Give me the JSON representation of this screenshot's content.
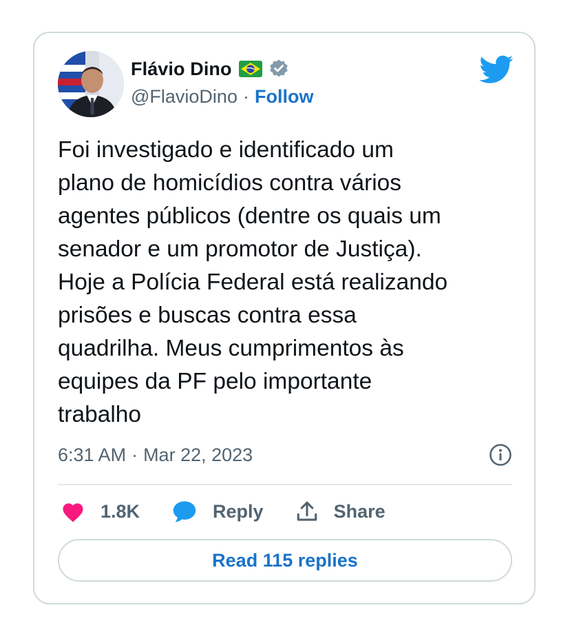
{
  "tweet": {
    "author": {
      "name": "Flávio Dino",
      "handle": "@FlavioDino",
      "separator": "·",
      "follow_label": "Follow",
      "flag_icon": "brazil-flag-icon",
      "verified_icon": "verified-badge-icon"
    },
    "logo_icon": "twitter-bird-icon",
    "text": "Foi investigado e identificado um\nplano de homicídios contra vários\nagentes públicos (dentre os quais um\nsenador e um promotor de Justiça).\nHoje a Polícia Federal está realizando\nprisões e buscas contra essa\nquadrilha. Meus cumprimentos às\nequipes da PF pelo importante\ntrabalho",
    "time": "6:31 AM",
    "meta_separator": "·",
    "date": "Mar 22, 2023",
    "actions": {
      "likes": "1.8K",
      "reply_label": "Reply",
      "share_label": "Share"
    },
    "read_replies_label": "Read 115 replies"
  },
  "colors": {
    "twitter_blue": "#1d9bf0",
    "link_blue": "#1a73c9",
    "like_pink": "#f91880",
    "secondary_text": "#536471",
    "border": "#cfd9de"
  }
}
